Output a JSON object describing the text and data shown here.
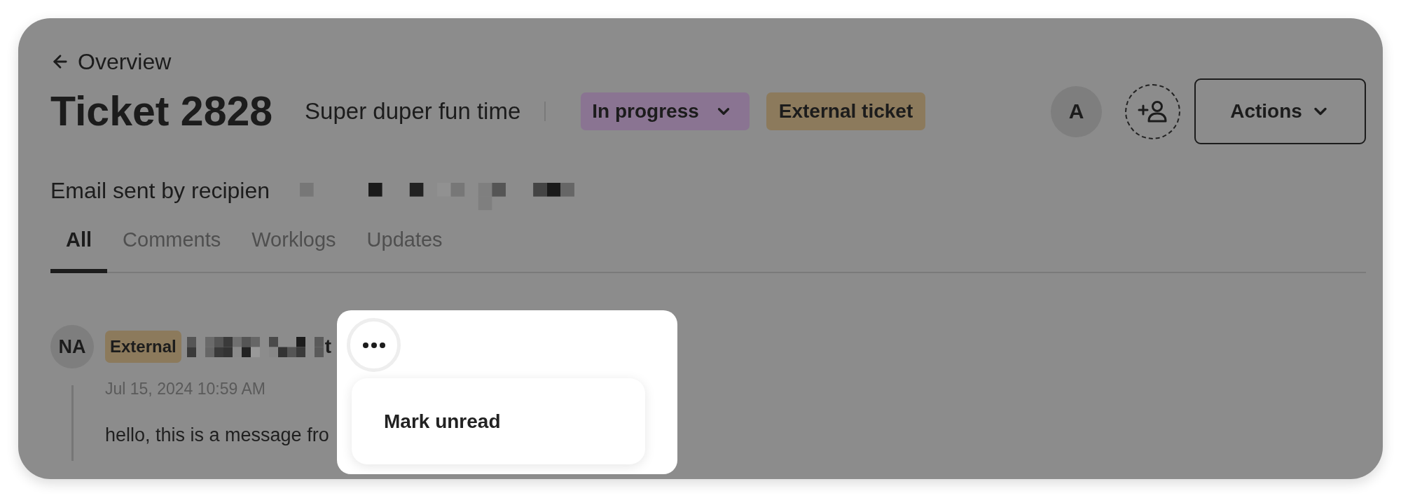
{
  "header": {
    "back_link": "Overview",
    "title": "Ticket 2828",
    "subtitle": "Super duper fun time",
    "status": "In progress",
    "tag": "External ticket",
    "assignee_initial": "A",
    "actions_label": "Actions"
  },
  "sender": {
    "label": "Email sent by recipien"
  },
  "tabs": [
    {
      "label": "All",
      "selected": true
    },
    {
      "label": "Comments",
      "selected": false
    },
    {
      "label": "Worklogs",
      "selected": false
    },
    {
      "label": "Updates",
      "selected": false
    }
  ],
  "comments": [
    {
      "initials": "NA",
      "badge": "External",
      "author_visible": "t",
      "date": "Jul 15, 2024 10:59 AM",
      "body": "hello, this is a message fro"
    }
  ],
  "popover": {
    "menu_items": [
      {
        "label": "Mark unread"
      }
    ]
  }
}
